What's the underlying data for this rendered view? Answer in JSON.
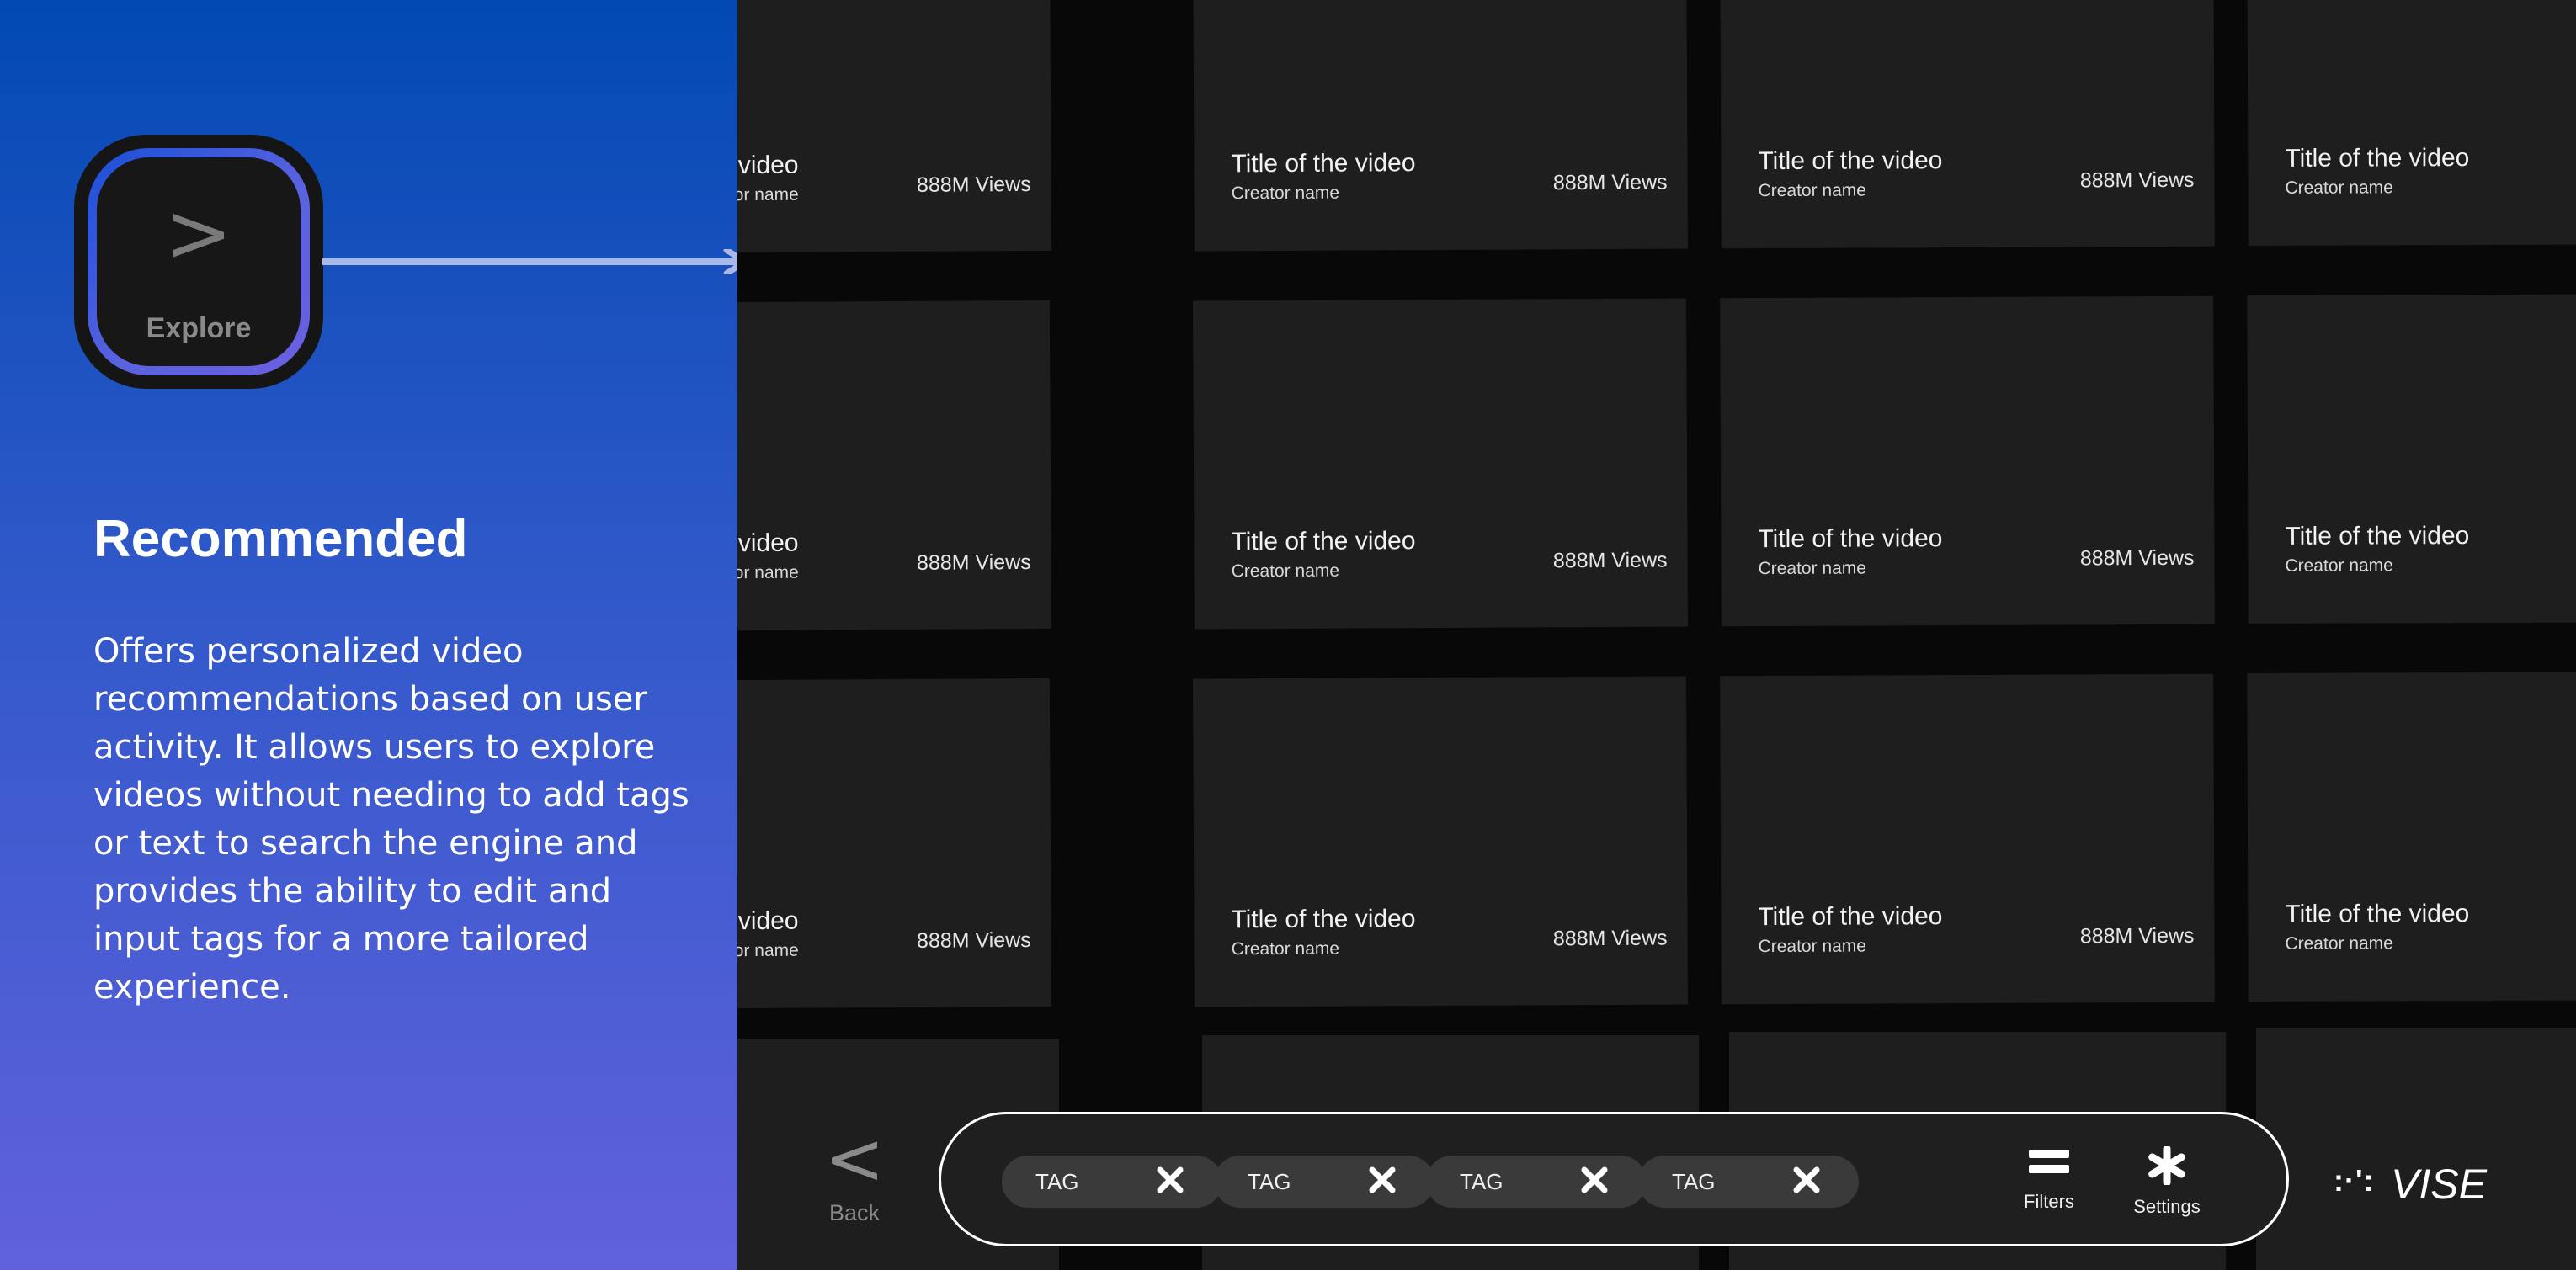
{
  "explore_button": {
    "icon": "chevron-right-icon",
    "glyph": ">",
    "label": "Explore"
  },
  "section": {
    "title": "Recommended",
    "description": "Offers personalized video recommendations based on user activity. It allows users to explore videos without needing to add tags or text to search the engine and provides the ability to edit and input tags for a more tailored experience."
  },
  "video_grid": {
    "rows": [
      [
        {
          "title": "Title of the video",
          "creator": "Creator name",
          "views": "888M Views"
        },
        {
          "title": "Title of the video",
          "creator": "Creator name",
          "views": "888M Views"
        },
        {
          "title": "Title of the video",
          "creator": "Creator name",
          "views": "888M Views"
        },
        {
          "title": "Title of the video",
          "creator": "Creator name",
          "views": ""
        }
      ],
      [
        {
          "title": "Title of the video",
          "creator": "Creator name",
          "views": "888M Views"
        },
        {
          "title": "Title of the video",
          "creator": "Creator name",
          "views": "888M Views"
        },
        {
          "title": "Title of the video",
          "creator": "Creator name",
          "views": "888M Views"
        },
        {
          "title": "Title of the video",
          "creator": "Creator name",
          "views": ""
        }
      ],
      [
        {
          "title": "Title of the video",
          "creator": "Creator name",
          "views": "888M Views"
        },
        {
          "title": "Title of the video",
          "creator": "Creator name",
          "views": "888M Views"
        },
        {
          "title": "Title of the video",
          "creator": "Creator name",
          "views": "888M Views"
        },
        {
          "title": "Title of the video",
          "creator": "Creator name",
          "views": ""
        }
      ]
    ]
  },
  "bottom_bar": {
    "back": {
      "icon": "chevron-left-icon",
      "glyph": "<",
      "label": "Back"
    },
    "tags": [
      {
        "label": "TAG"
      },
      {
        "label": "TAG"
      },
      {
        "label": "TAG"
      },
      {
        "label": "TAG"
      }
    ],
    "filters": {
      "icon": "equals-icon",
      "label": "Filters"
    },
    "settings": {
      "icon": "asterisk-icon",
      "label": "Settings"
    }
  },
  "brand": {
    "dots": ":·': ",
    "name": "VISE"
  },
  "colors": {
    "gradient_top": "#0249b4",
    "gradient_bottom": "#6161dc",
    "card_bg": "#1e1e1e",
    "grid_bg": "#080808",
    "ring_accent": "#5962e0"
  }
}
